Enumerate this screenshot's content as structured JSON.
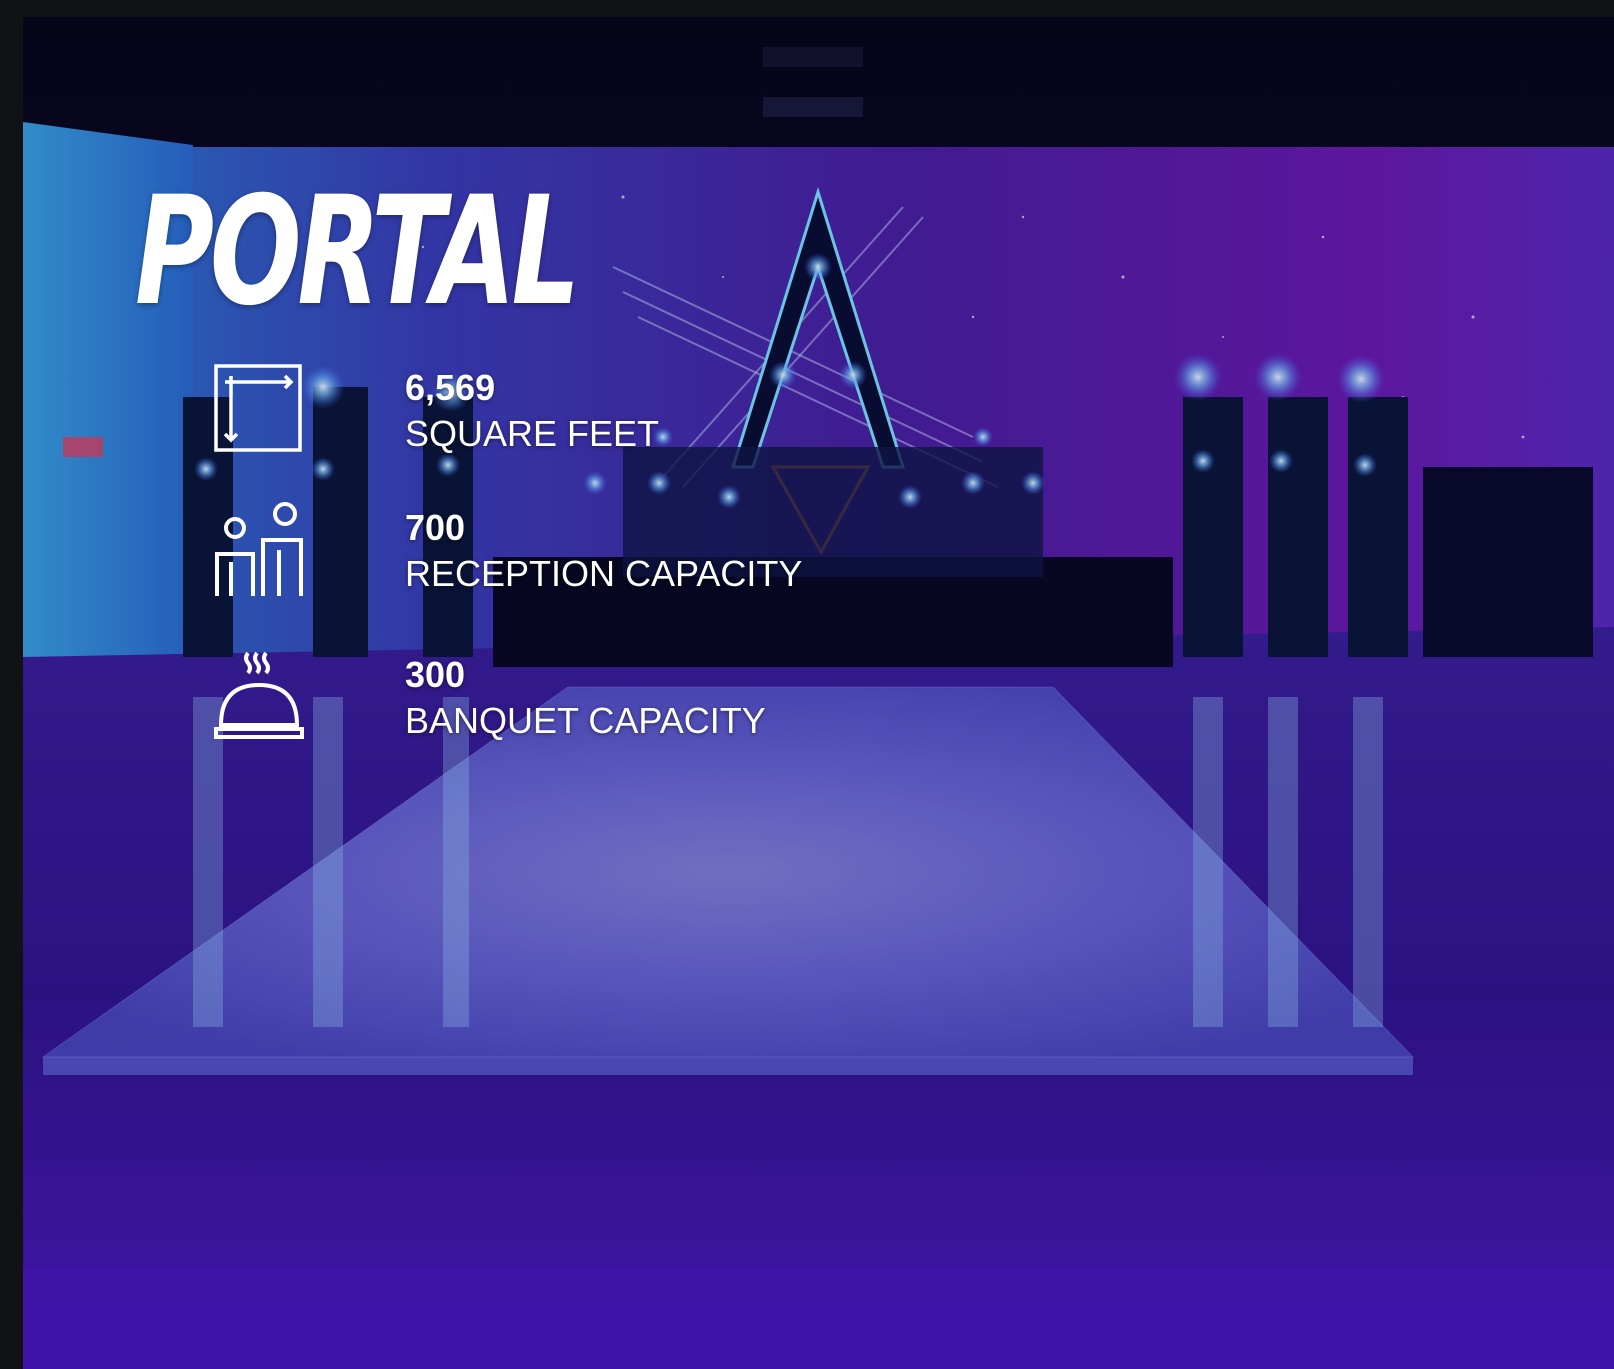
{
  "venue": {
    "name": "PORTAL"
  },
  "stats": [
    {
      "icon": "floor-plan-dimensions-icon",
      "value": "6,569",
      "label": "SQUARE FEET"
    },
    {
      "icon": "people-icon",
      "value": "700",
      "label": "RECEPTION CAPACITY"
    },
    {
      "icon": "food-cloche-icon",
      "value": "300",
      "label": "BANQUET CAPACITY"
    }
  ],
  "colors": {
    "frame": "#111214",
    "text": "#ffffff",
    "wall_purple": "#5a1aa8",
    "wall_blue": "#2a5fc8",
    "floor": "#3a1a9a"
  }
}
